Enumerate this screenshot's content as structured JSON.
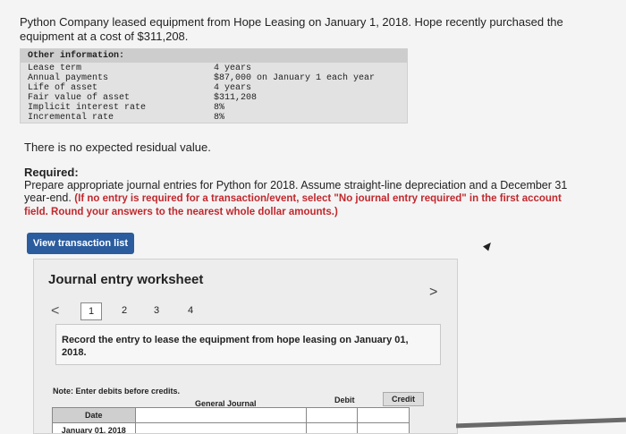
{
  "problem": {
    "text": "Python Company leased equipment from Hope Leasing on January 1, 2018. Hope recently purchased the equipment at a cost of $311,208."
  },
  "info": {
    "header": "Other information:",
    "labels": [
      "Lease term",
      "Annual payments",
      "Life of asset",
      "Fair value of asset",
      "Implicit interest rate",
      "Incremental rate"
    ],
    "values": [
      "4 years",
      "$87,000 on January 1 each year",
      "4 years",
      "$311,208",
      "8%",
      "8%"
    ]
  },
  "residual_text": "There is no expected residual value.",
  "required": {
    "title": "Required:",
    "body": "Prepare appropriate journal entries for Python for 2018. Assume straight-line depreciation and a December 31 year-end.",
    "note": "(If no entry is required for a transaction/event, select \"No journal entry required\" in the first account field. Round your answers to the nearest whole dollar amounts.)"
  },
  "view_button_label": "View transaction list",
  "worksheet": {
    "title": "Journal entry worksheet",
    "prev_glyph": "<",
    "next_glyph": ">",
    "steps": [
      "1",
      "2",
      "3",
      "4"
    ],
    "instruction": "Record the entry to lease the equipment from hope leasing on January 01, 2018.",
    "note": "Note: Enter debits before credits.",
    "columns": {
      "date": "Date",
      "general_journal": "General Journal",
      "debit": "Debit",
      "credit": "Credit"
    },
    "first_date": "January 01, 2018"
  }
}
